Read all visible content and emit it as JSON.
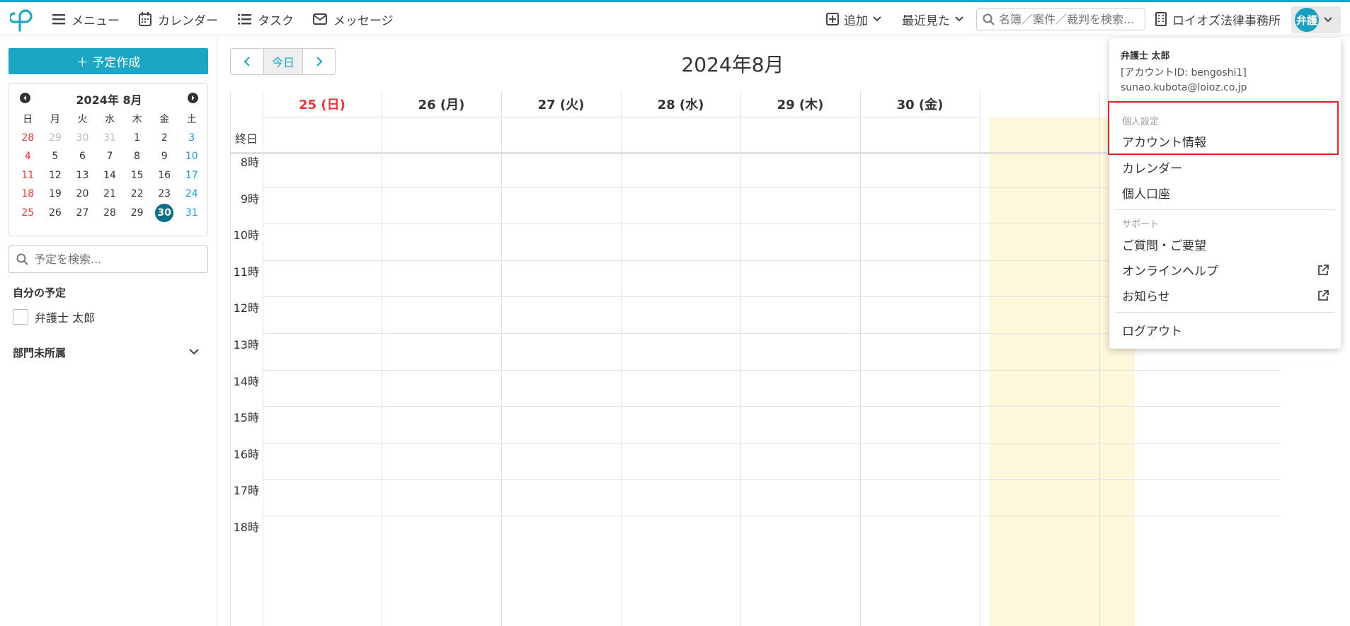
{
  "header": {
    "nav": [
      {
        "label": "メニュー",
        "icon": "hamburger-icon"
      },
      {
        "label": "カレンダー",
        "icon": "calendar-icon"
      },
      {
        "label": "タスク",
        "icon": "list-icon"
      },
      {
        "label": "メッセージ",
        "icon": "mail-icon"
      }
    ],
    "add_label": "追加",
    "recent_label": "最近見た",
    "search_placeholder": "名簿／案件／裁判を検索...",
    "office_name": "ロイオズ法律事務所",
    "avatar_text": "弁護"
  },
  "sidebar": {
    "create_button": "＋ 予定作成",
    "mini_calendar": {
      "title": "2024年 8月",
      "weekdays": [
        "日",
        "月",
        "火",
        "水",
        "木",
        "金",
        "土"
      ],
      "weeks": [
        [
          "28",
          "29",
          "30",
          "31",
          "1",
          "2",
          "3"
        ],
        [
          "4",
          "5",
          "6",
          "7",
          "8",
          "9",
          "10"
        ],
        [
          "11",
          "12",
          "13",
          "14",
          "15",
          "16",
          "17"
        ],
        [
          "18",
          "19",
          "20",
          "21",
          "22",
          "23",
          "24"
        ],
        [
          "25",
          "26",
          "27",
          "28",
          "29",
          "30",
          "31"
        ]
      ],
      "today": "30"
    },
    "search_placeholder": "予定を検索...",
    "my_schedule_label": "自分の予定",
    "user_checkbox_label": "弁護士 太郎",
    "department_label": "部門未所属"
  },
  "calendar": {
    "today_button": "今日",
    "title": "2024年8月",
    "days": [
      "25 (日)",
      "26 (月)",
      "27 (火)",
      "28 (水)",
      "29 (木)",
      "30 (金)"
    ],
    "allday_label": "終日",
    "hours": [
      "8時",
      "9時",
      "10時",
      "11時",
      "12時",
      "13時",
      "14時",
      "15時",
      "16時",
      "17時",
      "18時"
    ],
    "sunday_color": "#e53935",
    "today_bg": "#fdf7dc"
  },
  "dropdown": {
    "user_name": "弁護士 太郎",
    "account_id": "[アカウントID: bengoshi1]",
    "email": "sunao.kubota@loioz.co.jp",
    "personal_section": "個人設定",
    "account_info": "アカウント情報",
    "calendar": "カレンダー",
    "personal_account": "個人口座",
    "support_section": "サポート",
    "questions": "ご質問・ご要望",
    "online_help": "オンラインヘルプ",
    "news": "お知らせ",
    "logout": "ログアウト"
  },
  "colors": {
    "accent": "#1ba6c4",
    "highlight": "#e02424"
  }
}
